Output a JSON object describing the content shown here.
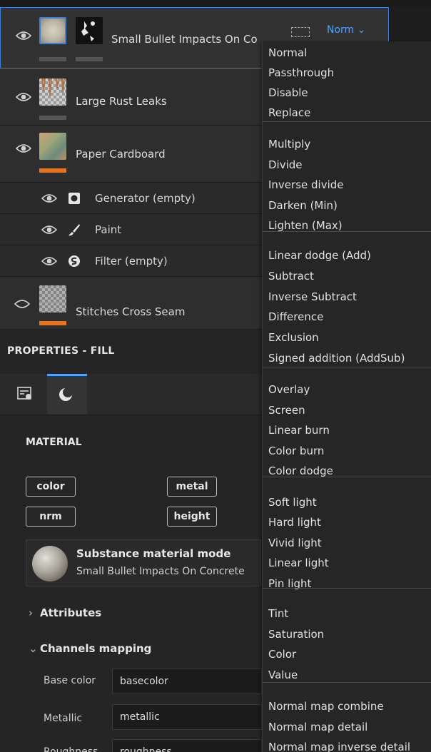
{
  "layers": [
    {
      "name": "Small Bullet Impacts On Co",
      "blend": "Norm",
      "blend_chevron": "⌄",
      "visible": true,
      "selected": true,
      "mask_color": "#555555"
    },
    {
      "name": "Large Rust Leaks",
      "visible": true,
      "selected": false,
      "mask_color": "#555555"
    },
    {
      "name": "Paper Cardboard",
      "visible": true,
      "selected": false,
      "mask_color": "#e8731f"
    },
    {
      "name": "Stitches Cross Seam",
      "visible": false,
      "selected": false,
      "mask_color": "#e8731f"
    }
  ],
  "sub_layers": [
    {
      "label": "Generator (empty)",
      "icon": "generator-icon"
    },
    {
      "label": "Paint",
      "icon": "brush-icon"
    },
    {
      "label": "Filter (empty)",
      "icon": "filter-icon"
    }
  ],
  "properties": {
    "title": "PROPERTIES - FILL",
    "tabs": [
      {
        "icon": "fill-settings-icon"
      },
      {
        "icon": "material-ball-icon"
      }
    ],
    "material_title": "MATERIAL",
    "channels": {
      "color": "color",
      "metal": "metal",
      "nrm": "nrm",
      "height": "height"
    },
    "substance": {
      "title": "Substance material mode",
      "subtitle": "Small Bullet Impacts On Concrete"
    },
    "attributes_label": "Attributes",
    "attributes_chevron": "›",
    "channels_mapping_label": "Channels mapping",
    "channels_mapping_chevron": "⌄",
    "mapping": [
      {
        "label": "Base color",
        "value": "basecolor"
      },
      {
        "label": "Metallic",
        "value": "metallic"
      },
      {
        "label": "Roughness",
        "value": "roughness"
      }
    ]
  },
  "blend_menu": {
    "groups": [
      [
        "Normal",
        "Passthrough",
        "Disable",
        "Replace"
      ],
      [
        "Multiply",
        "Divide",
        "Inverse divide",
        "Darken (Min)",
        "Lighten (Max)"
      ],
      [
        "Linear dodge (Add)",
        "Subtract",
        "Inverse Subtract",
        "Difference",
        "Exclusion",
        "Signed addition (AddSub)"
      ],
      [
        "Overlay",
        "Screen",
        "Linear burn",
        "Color burn",
        "Color dodge"
      ],
      [
        "Soft light",
        "Hard light",
        "Vivid light",
        "Linear light",
        "Pin light"
      ],
      [
        "Tint",
        "Saturation",
        "Color",
        "Value"
      ],
      [
        "Normal map combine",
        "Normal map detail",
        "Normal map inverse detail"
      ]
    ]
  },
  "colors": {
    "accent": "#4fa3ff",
    "selection": "#3f7fd6",
    "mask_orange": "#e8731f"
  }
}
